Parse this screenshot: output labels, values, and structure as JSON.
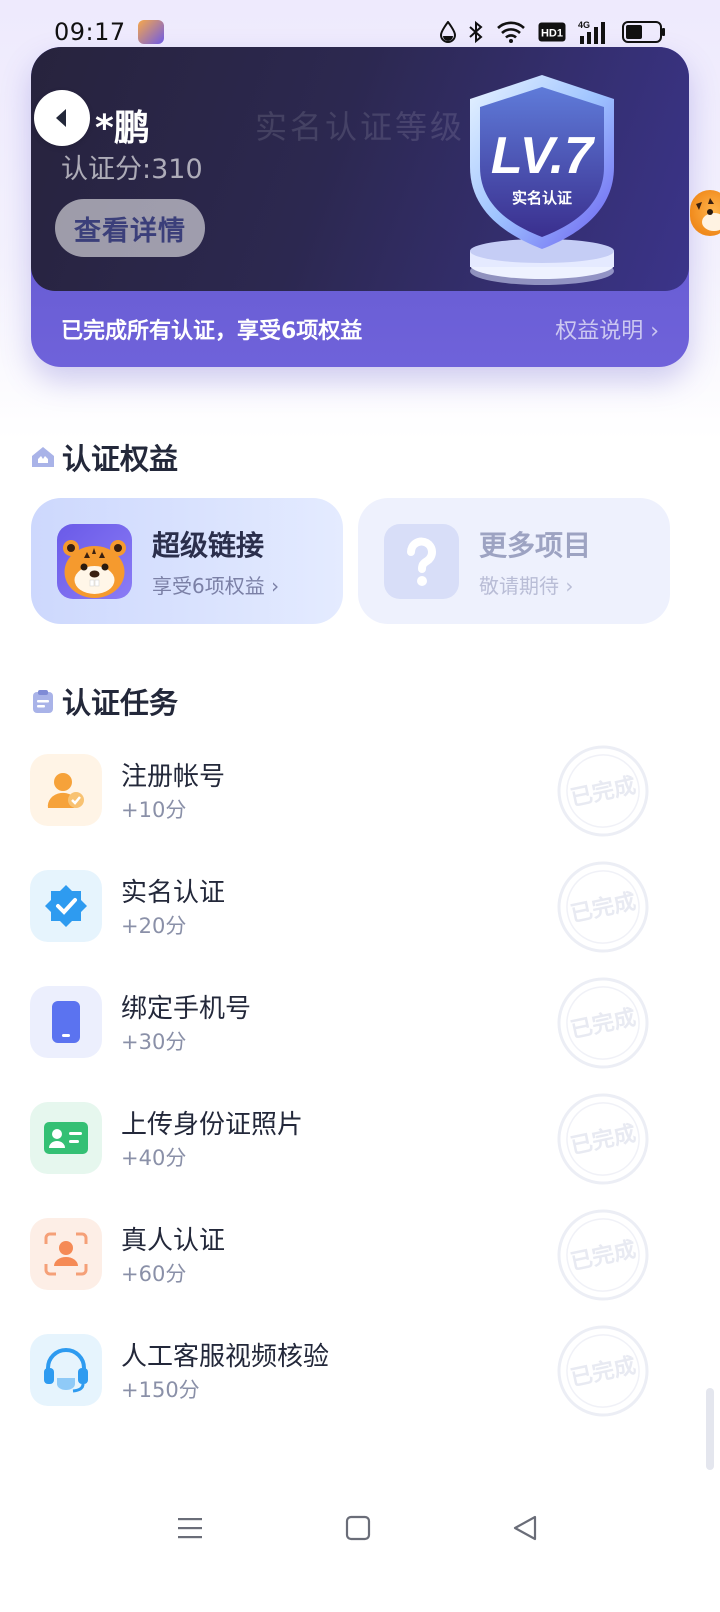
{
  "status_bar": {
    "time": "09:17",
    "icons": [
      "app-notification-icon",
      "water-drop-icon",
      "bluetooth-icon",
      "wifi-icon",
      "hd-icon",
      "4g-signal-icon",
      "battery-icon"
    ],
    "hd_label": "HD1",
    "network_label": "4G"
  },
  "level_card": {
    "user_name": "*鹏",
    "score": "认证分:310",
    "watermark": "实名认证等级",
    "details_button": "查看详情",
    "badge_level": "LV.7",
    "badge_caption": "实名认证",
    "footer_text": "已完成所有认证，享受6项权益",
    "footer_link": "权益说明"
  },
  "benefits": {
    "title": "认证权益",
    "items": [
      {
        "name": "超级链接",
        "subtitle": "享受6项权益",
        "icon": "tiger-mascot-icon",
        "active": true
      },
      {
        "name": "更多项目",
        "subtitle": "敬请期待",
        "icon": "question-mark-icon",
        "active": false
      }
    ]
  },
  "tasks": {
    "title": "认证任务",
    "stamp_text": "已完成",
    "items": [
      {
        "name": "注册帐号",
        "points": "+10分",
        "icon": "register-user-icon"
      },
      {
        "name": "实名认证",
        "points": "+20分",
        "icon": "verified-badge-icon"
      },
      {
        "name": "绑定手机号",
        "points": "+30分",
        "icon": "phone-icon"
      },
      {
        "name": "上传身份证照片",
        "points": "+40分",
        "icon": "id-card-icon"
      },
      {
        "name": "真人认证",
        "points": "+60分",
        "icon": "face-scan-icon"
      },
      {
        "name": "人工客服视频核验",
        "points": "+150分",
        "icon": "headset-icon"
      }
    ]
  },
  "colors": {
    "card_dark": "#27233d",
    "card_purple": "#5c54c8",
    "benefit_active": "#cdd8fd",
    "benefit_inactive": "#eef1fd"
  },
  "nav": [
    "menu-icon",
    "home-square-icon",
    "back-triangle-icon"
  ]
}
